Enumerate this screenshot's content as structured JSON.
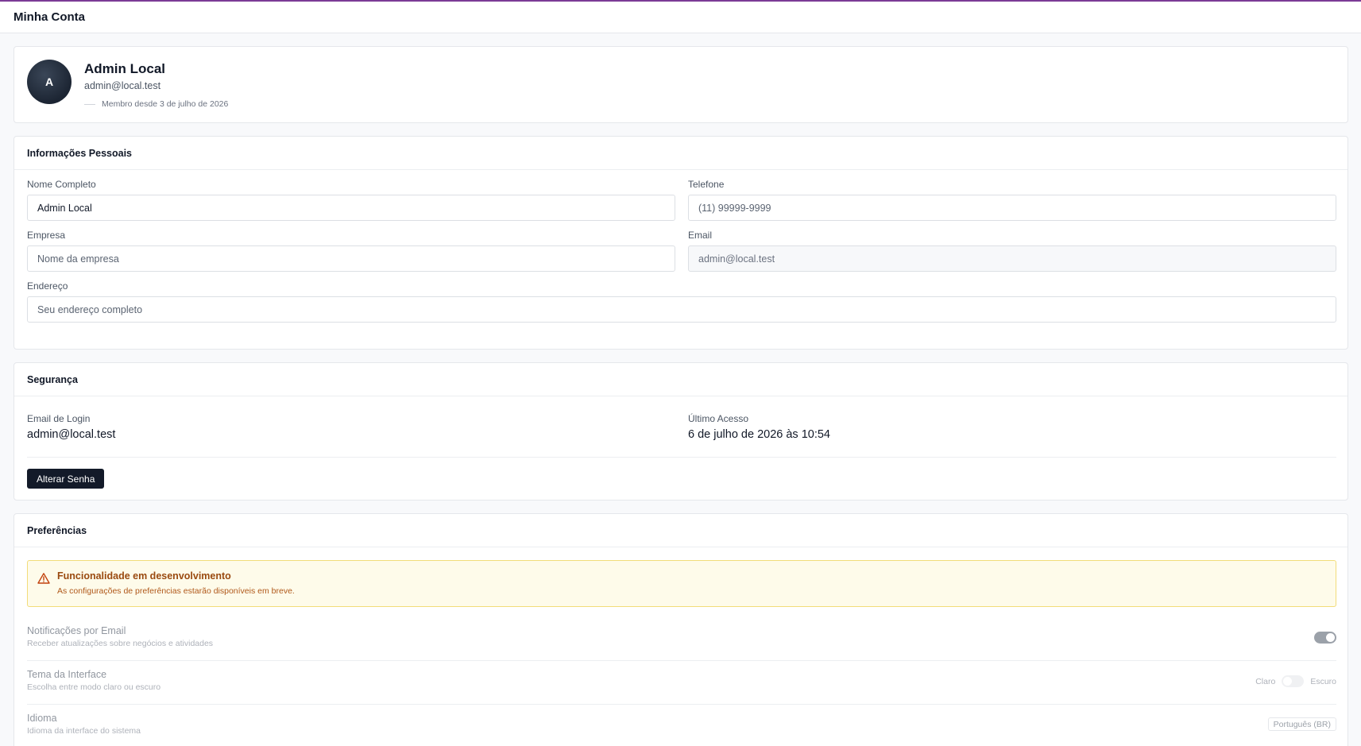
{
  "header": {
    "title": "Minha Conta"
  },
  "profile": {
    "avatar_initial": "A",
    "name": "Admin Local",
    "email": "admin@local.test",
    "member_since": "Membro desde 3 de julho de 2026"
  },
  "personal": {
    "title": "Informações Pessoais",
    "full_name": {
      "label": "Nome Completo",
      "value": "Admin Local"
    },
    "phone": {
      "label": "Telefone",
      "placeholder": "(11) 99999-9999"
    },
    "company": {
      "label": "Empresa",
      "placeholder": "Nome da empresa"
    },
    "email": {
      "label": "Email",
      "value": "admin@local.test"
    },
    "address": {
      "label": "Endereço",
      "placeholder": "Seu endereço completo"
    }
  },
  "security": {
    "title": "Segurança",
    "login_email_label": "Email de Login",
    "login_email_value": "admin@local.test",
    "last_access_label": "Último Acesso",
    "last_access_value": "6 de julho de 2026 às 10:54",
    "change_password_label": "Alterar Senha"
  },
  "preferences": {
    "title": "Preferências",
    "warning_title": "Funcionalidade em desenvolvimento",
    "warning_desc": "As configurações de preferências estarão disponíveis em breve.",
    "email_notif_title": "Notificações por Email",
    "email_notif_desc": "Receber atualizações sobre negócios e atividades",
    "email_notif_enabled": true,
    "theme_title": "Tema da Interface",
    "theme_desc": "Escolha entre modo claro ou escuro",
    "theme_light": "Claro",
    "theme_dark": "Escuro",
    "language_title": "Idioma",
    "language_desc": "Idioma da interface do sistema",
    "language_value": "Português (BR)"
  },
  "colors": {
    "accent_line": "#7b3a96",
    "primary_button": "#131a29",
    "warning_bg": "#fefbea",
    "warning_text": "#9a4a10"
  }
}
